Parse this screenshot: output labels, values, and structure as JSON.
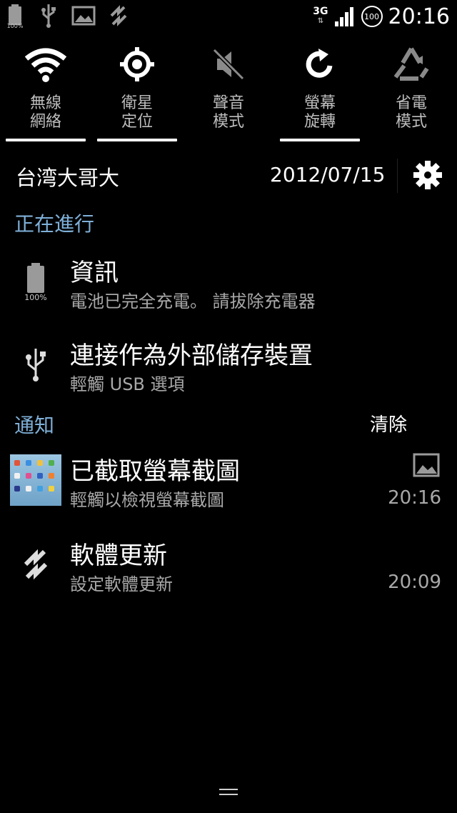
{
  "status_bar": {
    "battery_text": "100%",
    "network_label": "3G",
    "badge": "100",
    "time": "20:16",
    "left_icons": [
      "battery-icon",
      "usb-icon",
      "image-icon",
      "sync-icon"
    ],
    "right_icons": [
      "3g-data-icon",
      "signal-icon",
      "badge-100-icon"
    ]
  },
  "quick_toggles": [
    {
      "label": "無線\n網絡",
      "icon": "wifi-icon",
      "active": true
    },
    {
      "label": "衛星\n定位",
      "icon": "gps-icon",
      "active": true
    },
    {
      "label": "聲音\n模式",
      "icon": "mute-icon",
      "active": false
    },
    {
      "label": "螢幕\n旋轉",
      "icon": "rotate-icon",
      "active": true
    },
    {
      "label": "省電\n模式",
      "icon": "recycle-icon",
      "active": false
    }
  ],
  "header": {
    "carrier": "台湾大哥大",
    "date": "2012/07/15",
    "settings_icon": "gear-icon"
  },
  "ongoing": {
    "title": "正在進行",
    "items": [
      {
        "icon": "battery-icon",
        "icon_text": "100%",
        "title": "資訊",
        "subtitle": "電池已完全充電。 請拔除充電器"
      },
      {
        "icon": "usb-icon",
        "title": "連接作為外部儲存裝置",
        "subtitle": "輕觸 USB 選項"
      }
    ]
  },
  "notifications": {
    "title": "通知",
    "clear_label": "清除",
    "items": [
      {
        "icon": "screenshot-thumbnail",
        "title": "已截取螢幕截圖",
        "subtitle": "輕觸以檢視螢幕截圖",
        "time": "20:16",
        "small_icon": "image-icon"
      },
      {
        "icon": "sync-icon",
        "title": "軟體更新",
        "subtitle": "設定軟體更新",
        "time": "20:09"
      }
    ]
  },
  "colors": {
    "background": "#000000",
    "section_title": "#7fb0d8",
    "secondary_text": "#a8a8a8"
  }
}
